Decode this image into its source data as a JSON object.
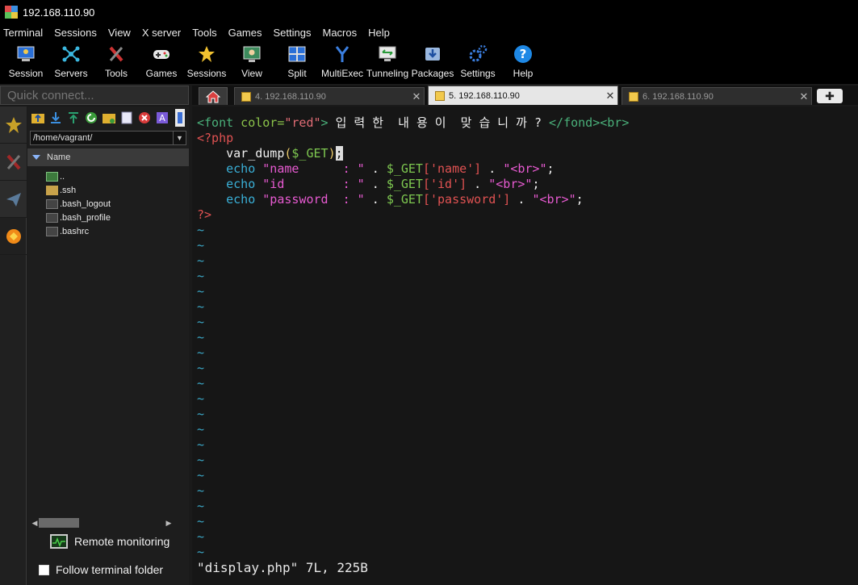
{
  "window": {
    "title": "192.168.110.90"
  },
  "menu": [
    "Terminal",
    "Sessions",
    "View",
    "X server",
    "Tools",
    "Games",
    "Settings",
    "Macros",
    "Help"
  ],
  "toolbar": [
    {
      "label": "Session",
      "icon": "session-icon"
    },
    {
      "label": "Servers",
      "icon": "servers-icon"
    },
    {
      "label": "Tools",
      "icon": "tools-icon"
    },
    {
      "label": "Games",
      "icon": "games-icon"
    },
    {
      "label": "Sessions",
      "icon": "sessions-star-icon"
    },
    {
      "label": "View",
      "icon": "view-icon"
    },
    {
      "label": "Split",
      "icon": "split-icon"
    },
    {
      "label": "MultiExec",
      "icon": "multiexec-icon"
    },
    {
      "label": "Tunneling",
      "icon": "tunneling-icon"
    },
    {
      "label": "Packages",
      "icon": "packages-icon"
    },
    {
      "label": "Settings",
      "icon": "settings-icon"
    },
    {
      "label": "Help",
      "icon": "help-icon"
    }
  ],
  "quick_connect": {
    "placeholder": "Quick connect..."
  },
  "tabs": [
    {
      "label": "4. 192.168.110.90",
      "active": false
    },
    {
      "label": "5. 192.168.110.90",
      "active": true
    },
    {
      "label": "6. 192.168.110.90",
      "active": false
    }
  ],
  "file_browser": {
    "path": "/home/vagrant/",
    "column": "Name",
    "items": [
      {
        "name": "..",
        "type": "up"
      },
      {
        "name": ".ssh",
        "type": "folder"
      },
      {
        "name": ".bash_logout",
        "type": "file"
      },
      {
        "name": ".bash_profile",
        "type": "file"
      },
      {
        "name": ".bashrc",
        "type": "file"
      }
    ],
    "remote_monitoring": "Remote monitoring",
    "follow_folder": "Follow terminal folder"
  },
  "terminal": {
    "code": {
      "l1_a": "<font",
      "l1_b": " color=",
      "l1_c": "\"red\"",
      "l1_d": ">",
      "l1_text": " 입 력 한  내 용 이  맞 습 니 까 ? ",
      "l1_e": "</fond>",
      "l1_f": "<br>",
      "l2": "<?php",
      "l3_indent": "    ",
      "l3_fn": "var_dump",
      "l3_p1": "(",
      "l3_var": "$_GET",
      "l3_p2": ")",
      "l3_semi": ";",
      "l4_echo": "echo",
      "l4_str": " \"name      : \"",
      "l4_rest1": " . ",
      "l4_var": "$_GET",
      "l4_key": "['name']",
      "l4_rest2": " . ",
      "l4_str2a": "\"",
      "l4_br": "<br>",
      "l4_str2b": "\"",
      "l4_end": ";",
      "l5_echo": "echo",
      "l5_str": " \"id        : \"",
      "l5_rest1": " . ",
      "l5_var": "$_GET",
      "l5_key": "['id']",
      "l5_rest2": " . ",
      "l5_str2a": "\"",
      "l5_br": "<br>",
      "l5_str2b": "\"",
      "l5_end": ";",
      "l6_echo": "echo",
      "l6_str": " \"password  : \"",
      "l6_rest1": " . ",
      "l6_var": "$_GET",
      "l6_key": "['password']",
      "l6_rest2": " . ",
      "l6_str2a": "\"",
      "l6_br": "<br>",
      "l6_str2b": "\"",
      "l6_end": ";",
      "l7": "?>"
    },
    "tilde": "~",
    "status_line": "\"display.php\" 7L, 225B"
  }
}
